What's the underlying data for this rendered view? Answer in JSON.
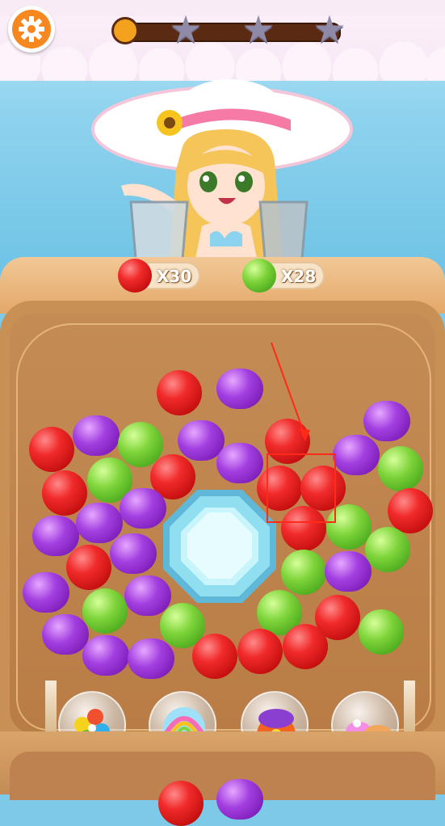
{
  "settings": {
    "icon": "gear-icon",
    "color": "#f7881f"
  },
  "progress": {
    "value": 0.0,
    "stars": [
      "star-icon",
      "star-icon",
      "star-icon"
    ]
  },
  "goals": [
    {
      "fruit": "red-apple",
      "label": "X30",
      "color": "#e21b1b"
    },
    {
      "fruit": "green-apple",
      "label": "X28",
      "color": "#5fbe2c"
    }
  ],
  "board": {
    "center_tile": "crystal-gem",
    "hint": "swap-hint"
  },
  "powerups": [
    {
      "name": "rainbow-pinwheel"
    },
    {
      "name": "rainbow-bubble"
    },
    {
      "name": "fruit-bomb"
    },
    {
      "name": "cupcake"
    }
  ]
}
